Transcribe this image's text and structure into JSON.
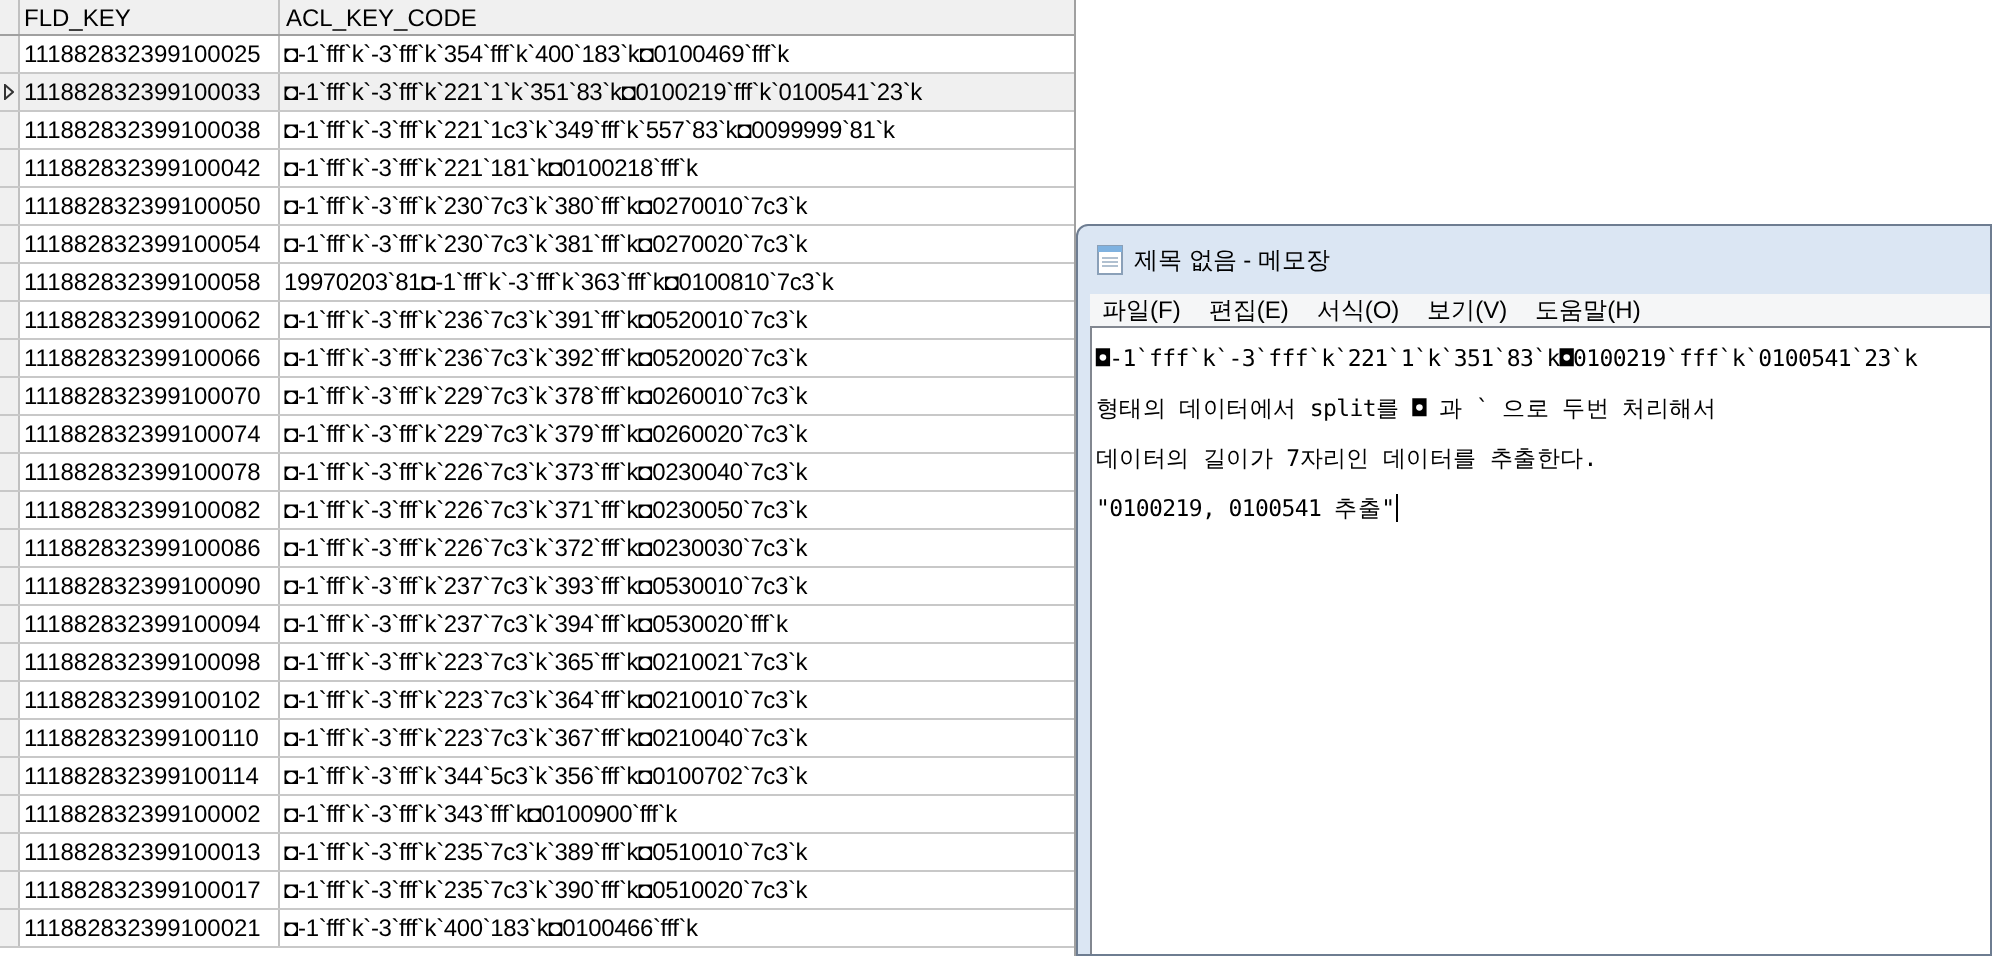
{
  "grid": {
    "columns": [
      "FLD_KEY",
      "ACL_KEY_CODE"
    ],
    "rows": [
      {
        "fld_key": "111882832399100025",
        "acl_key_code": "◘-1`fff`k`-3`fff`k`354`fff`k`400`183`k◘0100469`fff`k",
        "selected": false
      },
      {
        "fld_key": "111882832399100033",
        "acl_key_code": "◘-1`fff`k`-3`fff`k`221`1`k`351`83`k◘0100219`fff`k`0100541`23`k",
        "selected": true
      },
      {
        "fld_key": "111882832399100038",
        "acl_key_code": "◘-1`fff`k`-3`fff`k`221`1c3`k`349`fff`k`557`83`k◘0099999`81`k",
        "selected": false
      },
      {
        "fld_key": "111882832399100042",
        "acl_key_code": "◘-1`fff`k`-3`fff`k`221`181`k◘0100218`fff`k",
        "selected": false
      },
      {
        "fld_key": "111882832399100050",
        "acl_key_code": "◘-1`fff`k`-3`fff`k`230`7c3`k`380`fff`k◘0270010`7c3`k",
        "selected": false
      },
      {
        "fld_key": "111882832399100054",
        "acl_key_code": "◘-1`fff`k`-3`fff`k`230`7c3`k`381`fff`k◘0270020`7c3`k",
        "selected": false
      },
      {
        "fld_key": "111882832399100058",
        "acl_key_code": "19970203`81◘-1`fff`k`-3`fff`k`363`fff`k◘0100810`7c3`k",
        "selected": false
      },
      {
        "fld_key": "111882832399100062",
        "acl_key_code": "◘-1`fff`k`-3`fff`k`236`7c3`k`391`fff`k◘0520010`7c3`k",
        "selected": false
      },
      {
        "fld_key": "111882832399100066",
        "acl_key_code": "◘-1`fff`k`-3`fff`k`236`7c3`k`392`fff`k◘0520020`7c3`k",
        "selected": false
      },
      {
        "fld_key": "111882832399100070",
        "acl_key_code": "◘-1`fff`k`-3`fff`k`229`7c3`k`378`fff`k◘0260010`7c3`k",
        "selected": false
      },
      {
        "fld_key": "111882832399100074",
        "acl_key_code": "◘-1`fff`k`-3`fff`k`229`7c3`k`379`fff`k◘0260020`7c3`k",
        "selected": false
      },
      {
        "fld_key": "111882832399100078",
        "acl_key_code": "◘-1`fff`k`-3`fff`k`226`7c3`k`373`fff`k◘0230040`7c3`k",
        "selected": false
      },
      {
        "fld_key": "111882832399100082",
        "acl_key_code": "◘-1`fff`k`-3`fff`k`226`7c3`k`371`fff`k◘0230050`7c3`k",
        "selected": false
      },
      {
        "fld_key": "111882832399100086",
        "acl_key_code": "◘-1`fff`k`-3`fff`k`226`7c3`k`372`fff`k◘0230030`7c3`k",
        "selected": false
      },
      {
        "fld_key": "111882832399100090",
        "acl_key_code": "◘-1`fff`k`-3`fff`k`237`7c3`k`393`fff`k◘0530010`7c3`k",
        "selected": false
      },
      {
        "fld_key": "111882832399100094",
        "acl_key_code": "◘-1`fff`k`-3`fff`k`237`7c3`k`394`fff`k◘0530020`fff`k",
        "selected": false
      },
      {
        "fld_key": "111882832399100098",
        "acl_key_code": "◘-1`fff`k`-3`fff`k`223`7c3`k`365`fff`k◘0210021`7c3`k",
        "selected": false
      },
      {
        "fld_key": "111882832399100102",
        "acl_key_code": "◘-1`fff`k`-3`fff`k`223`7c3`k`364`fff`k◘0210010`7c3`k",
        "selected": false
      },
      {
        "fld_key": "111882832399100110",
        "acl_key_code": "◘-1`fff`k`-3`fff`k`223`7c3`k`367`fff`k◘0210040`7c3`k",
        "selected": false
      },
      {
        "fld_key": "111882832399100114",
        "acl_key_code": "◘-1`fff`k`-3`fff`k`344`5c3`k`356`fff`k◘0100702`7c3`k",
        "selected": false
      },
      {
        "fld_key": "111882832399100002",
        "acl_key_code": "◘-1`fff`k`-3`fff`k`343`fff`k◘0100900`fff`k",
        "selected": false
      },
      {
        "fld_key": "111882832399100013",
        "acl_key_code": "◘-1`fff`k`-3`fff`k`235`7c3`k`389`fff`k◘0510010`7c3`k",
        "selected": false
      },
      {
        "fld_key": "111882832399100017",
        "acl_key_code": "◘-1`fff`k`-3`fff`k`235`7c3`k`390`fff`k◘0510020`7c3`k",
        "selected": false
      },
      {
        "fld_key": "111882832399100021",
        "acl_key_code": "◘-1`fff`k`-3`fff`k`400`183`k◘0100466`fff`k",
        "selected": false
      }
    ]
  },
  "notepad": {
    "title": "제목 없음 - 메모장",
    "menu": [
      "파일(F)",
      "편집(E)",
      "서식(O)",
      "보기(V)",
      "도움말(H)"
    ],
    "lines": [
      "◘-1`fff`k`-3`fff`k`221`1`k`351`83`k◘0100219`fff`k`0100541`23`k",
      "형태의 데이터에서 split를 ◘ 과 ` 으로 두번 처리해서",
      "데이터의 길이가 7자리인 데이터를 추출한다.",
      "\"0100219, 0100541 추출\""
    ],
    "caret_on_last_line": true
  }
}
